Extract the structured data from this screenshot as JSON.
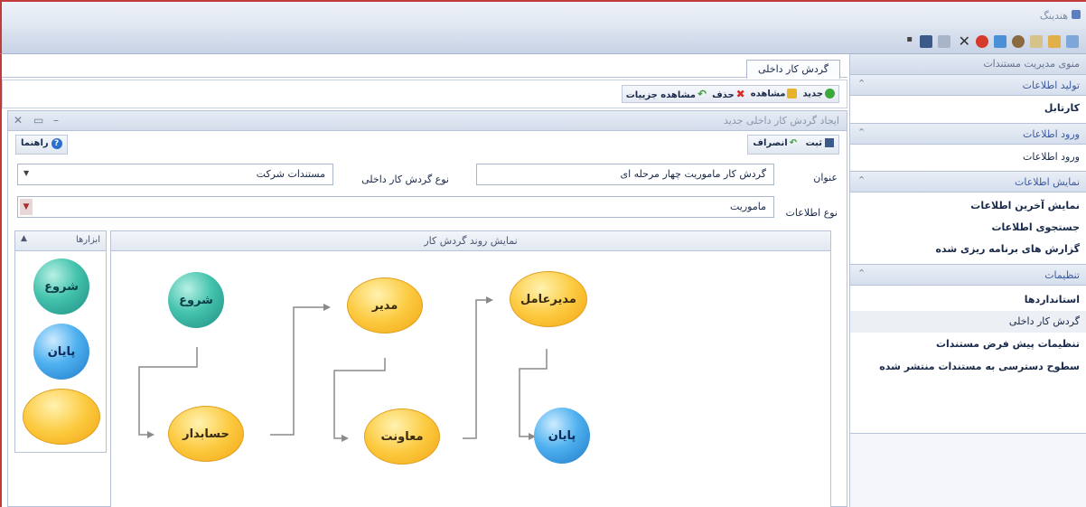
{
  "app": {
    "title": "هندینگ"
  },
  "main_tab": {
    "label": "گردش کار داخلی"
  },
  "actions": {
    "new_label": "جدید",
    "view_label": "مشاهده",
    "delete_label": "حذف",
    "details_label": "مشاهده جزییات"
  },
  "window": {
    "title": "ایجاد گردش کار داخلی جدید",
    "save_label": "ثبت",
    "cancel_label": "انصراف",
    "help_label": "راهنما"
  },
  "form": {
    "title_label": "عنوان",
    "title_value": "گردش کار ماموریت چهار مرحله ای",
    "type_label": "نوع گردش کار داخلی",
    "type_value": "مستندات شرکت",
    "info_type_label": "نوع اطلاعات",
    "info_type_value": "ماموریت"
  },
  "canvas": {
    "header": "نمایش روند گردش کار",
    "nodes": {
      "start": "شروع",
      "accountant": "حسابدار",
      "manager": "مدیر",
      "deputy": "معاونت",
      "ceo": "مدیرعامل",
      "end": "پایان"
    }
  },
  "tools": {
    "header": "ابزارها",
    "start": "شروع",
    "end": "پایان"
  },
  "nav": {
    "title": "منوی مدیریت مستندات",
    "groups": [
      {
        "header": "تولید اطلاعات",
        "items": [
          "کارتابل"
        ]
      },
      {
        "header": "ورود اطلاعات",
        "items": [
          "ورود اطلاعات"
        ]
      },
      {
        "header": "نمایش اطلاعات",
        "items": [
          "نمایش آخرین اطلاعات",
          "جستجوی اطلاعات",
          "گزارش های برنامه ریزی شده"
        ]
      },
      {
        "header": "تنظیمات",
        "items": [
          "استانداردها",
          "گردش کار داخلی",
          "تنظیمات پیش فرض مستندات",
          "سطوح دسترسی به مستندات منتشر شده"
        ]
      }
    ]
  },
  "colors": {
    "frame": "#c23a3a",
    "nav_header_text": "#3c5aa0"
  }
}
